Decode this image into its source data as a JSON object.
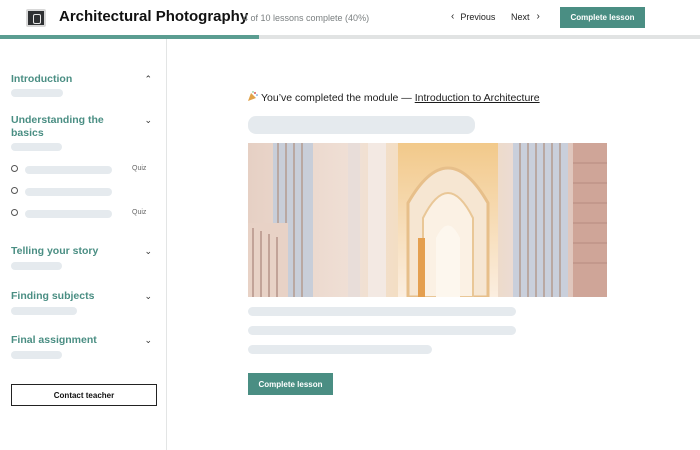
{
  "header": {
    "course_title": "Architectural Photography",
    "progress_text": "4 of 10 lessons complete (40%)",
    "progress_fraction": 0.37,
    "previous_label": "Previous",
    "next_label": "Next",
    "complete_label": "Complete lesson",
    "accent_color": "#4a8e83"
  },
  "sidebar": {
    "sections": [
      {
        "title": "Introduction",
        "chevron": "up"
      },
      {
        "title": "Understanding the basics",
        "chevron": "down"
      },
      {
        "title": "Telling your story",
        "chevron": "down"
      },
      {
        "title": "Finding subjects",
        "chevron": "down"
      },
      {
        "title": "Final assignment",
        "chevron": "down"
      }
    ],
    "lessons": [
      {
        "badge": "Quiz"
      },
      {
        "badge": ""
      },
      {
        "badge": "Quiz"
      }
    ],
    "contact_label": "Contact teacher"
  },
  "main": {
    "completed_prefix": "You’ve completed the module — ",
    "module_name": "Introduction to Architecture",
    "complete_label": "Complete lesson"
  }
}
